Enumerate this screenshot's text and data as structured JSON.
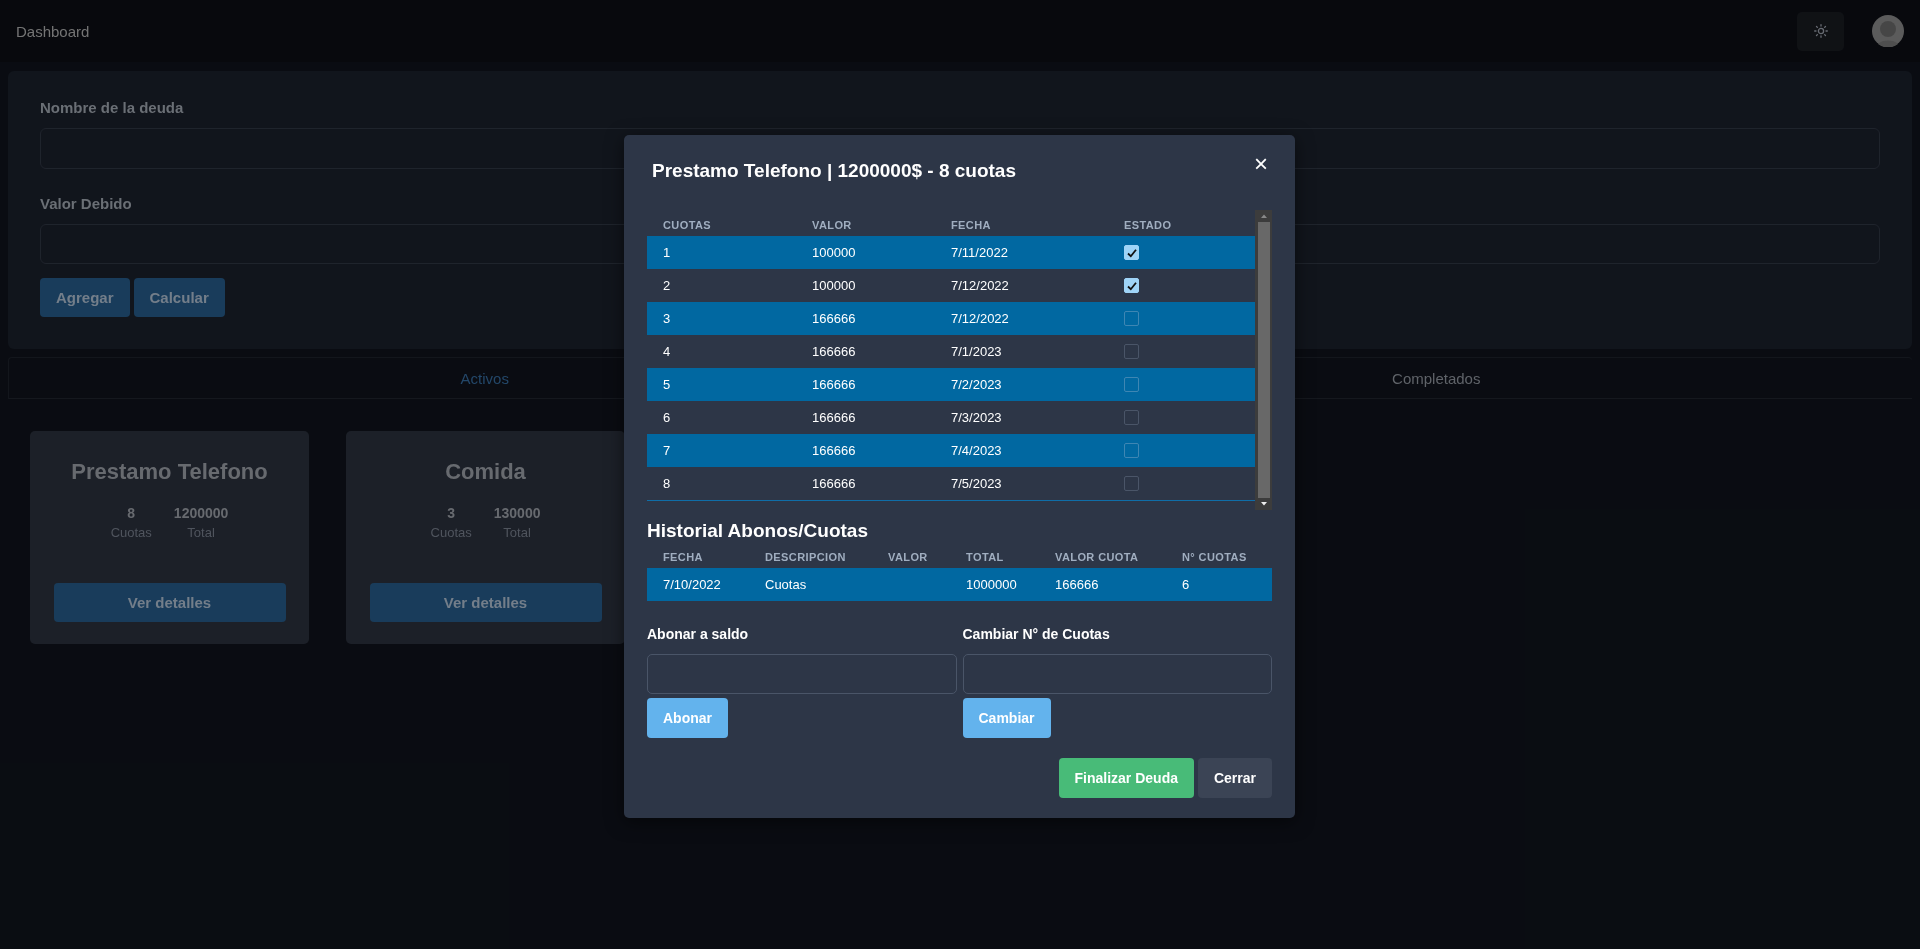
{
  "navbar": {
    "title": "Dashboard"
  },
  "form": {
    "fields": [
      {
        "label": "Nombre de la deuda"
      },
      {
        "label": "Valor Debido"
      }
    ],
    "buttons": [
      "Agregar",
      "Calcular"
    ]
  },
  "tabs": [
    {
      "label": "Activos",
      "selected": true
    },
    {
      "label": "Completados",
      "selected": false
    }
  ],
  "debts": [
    {
      "title": "Prestamo Telefono",
      "cuotas": "8",
      "cuotas_label": "Cuotas",
      "total": "1200000",
      "total_label": "Total",
      "button": "Ver detalles"
    },
    {
      "title": "Comida",
      "cuotas": "3",
      "cuotas_label": "Cuotas",
      "total": "130000",
      "total_label": "Total",
      "button": "Ver detalles"
    }
  ],
  "modal": {
    "title": "Prestamo Telefono | 1200000$ - 8 cuotas",
    "close": "×",
    "installments": {
      "columns": [
        "CUOTAS",
        "VALOR",
        "FECHA",
        "ESTADO"
      ],
      "rows": [
        {
          "cuota": "1",
          "valor": "100000",
          "fecha": "7/11/2022",
          "checked": true
        },
        {
          "cuota": "2",
          "valor": "100000",
          "fecha": "7/12/2022",
          "checked": true
        },
        {
          "cuota": "3",
          "valor": "166666",
          "fecha": "7/12/2022",
          "checked": false
        },
        {
          "cuota": "4",
          "valor": "166666",
          "fecha": "7/1/2023",
          "checked": false
        },
        {
          "cuota": "5",
          "valor": "166666",
          "fecha": "7/2/2023",
          "checked": false
        },
        {
          "cuota": "6",
          "valor": "166666",
          "fecha": "7/3/2023",
          "checked": false
        },
        {
          "cuota": "7",
          "valor": "166666",
          "fecha": "7/4/2023",
          "checked": false
        },
        {
          "cuota": "8",
          "valor": "166666",
          "fecha": "7/5/2023",
          "checked": false
        }
      ]
    },
    "history": {
      "title": "Historial Abonos/Cuotas",
      "columns": [
        "FECHA",
        "DESCRIPCION",
        "VALOR",
        "TOTAL",
        "VALOR CUOTA",
        "N° CUOTAS"
      ],
      "rows": [
        [
          "7/10/2022",
          "Cuotas",
          null,
          "1000000",
          "166666",
          "6"
        ]
      ]
    },
    "actions": [
      {
        "label": "Abonar a saldo",
        "button": "Abonar"
      },
      {
        "label": "Cambiar N° de Cuotas",
        "button": "Cambiar"
      }
    ],
    "footer": [
      {
        "label": "Finalizar Deuda",
        "kind": "primary"
      },
      {
        "label": "Cerrar",
        "kind": "secondary"
      }
    ]
  }
}
